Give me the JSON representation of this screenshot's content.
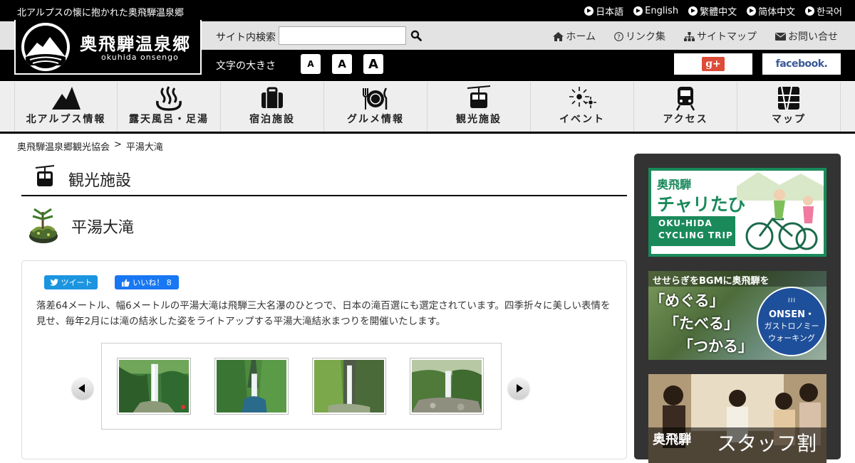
{
  "header": {
    "tagline": "北アルプスの懐に抱かれた奥飛騨温泉郷",
    "languages": [
      {
        "label": "日本語"
      },
      {
        "label": "English"
      },
      {
        "label": "繁體中文"
      },
      {
        "label": "简体中文"
      },
      {
        "label": "한국어"
      }
    ]
  },
  "logo": {
    "title": "奥飛騨温泉郷",
    "subtitle": "okuhida onsengo"
  },
  "search": {
    "label": "サイト内検索",
    "value": "",
    "placeholder": ""
  },
  "utility_nav": [
    {
      "label": "ホーム",
      "icon": "home-icon"
    },
    {
      "label": "リンク集",
      "icon": "question-icon"
    },
    {
      "label": "サイトマップ",
      "icon": "sitemap-icon"
    },
    {
      "label": "お問い合せ",
      "icon": "envelope-icon"
    }
  ],
  "font_size": {
    "label": "文字の大きさ",
    "buttons": [
      "A",
      "A",
      "A"
    ]
  },
  "social": {
    "google": "g+",
    "facebook": "facebook."
  },
  "main_nav": [
    {
      "label": "北アルプス情報",
      "icon": "mountain-icon"
    },
    {
      "label": "露天風呂・足湯",
      "icon": "hot-spring-icon"
    },
    {
      "label": "宿泊施設",
      "icon": "suitcase-icon"
    },
    {
      "label": "グルメ情報",
      "icon": "dining-icon"
    },
    {
      "label": "観光施設",
      "icon": "ropeway-icon"
    },
    {
      "label": "イベント",
      "icon": "fireworks-icon"
    },
    {
      "label": "アクセス",
      "icon": "train-icon"
    },
    {
      "label": "マップ",
      "icon": "map-icon"
    }
  ],
  "breadcrumb": {
    "home": "奥飛騨温泉郷観光協会",
    "separator": ">",
    "current": "平湯大滝"
  },
  "section": {
    "title": "観光施設",
    "icon": "ropeway-icon"
  },
  "item": {
    "title": "平湯大滝",
    "icon": "bonsai-icon"
  },
  "share": {
    "tweet": "ツイート",
    "like": "いいね！ 8"
  },
  "description": "落差64メートル、幅6メートルの平湯大滝は飛騨三大名瀑のひとつで、日本の滝百選にも選定されています。四季折々に美しい表情を見せ、毎年2月には滝の結氷した姿をライトアップする平湯大滝結氷まつりを開催いたします。",
  "gallery": {
    "thumbs": [
      "waterfall-photo-1",
      "waterfall-photo-2",
      "waterfall-photo-3",
      "waterfall-photo-4"
    ]
  },
  "sidebar": {
    "banner1": {
      "line1": "奥飛騨",
      "line2": "チャリたび",
      "line3": "OKU-HIDA",
      "line4": "CYCLING TRIP"
    },
    "banner2": {
      "top": "せせらぎをBGMに奥飛騨を",
      "l1": "「めぐる」",
      "l2": "「たべる」",
      "l3": "「つかる」",
      "badge1": "ONSEN・",
      "badge2": "ガストロノミー",
      "badge3": "ウォーキング"
    },
    "banner3": {
      "l1": "奥飛騨",
      "l2": "スタッフ割"
    }
  },
  "colors": {
    "topbar": "#000000",
    "gray_row": "#e3e3e3",
    "nav_bg": "#eeeeee",
    "sidebar": "#333333",
    "tweet": "#1b95e0",
    "facebook": "#1877f2",
    "google": "#dd4b39",
    "cycling_green": "#1a8a5b"
  }
}
